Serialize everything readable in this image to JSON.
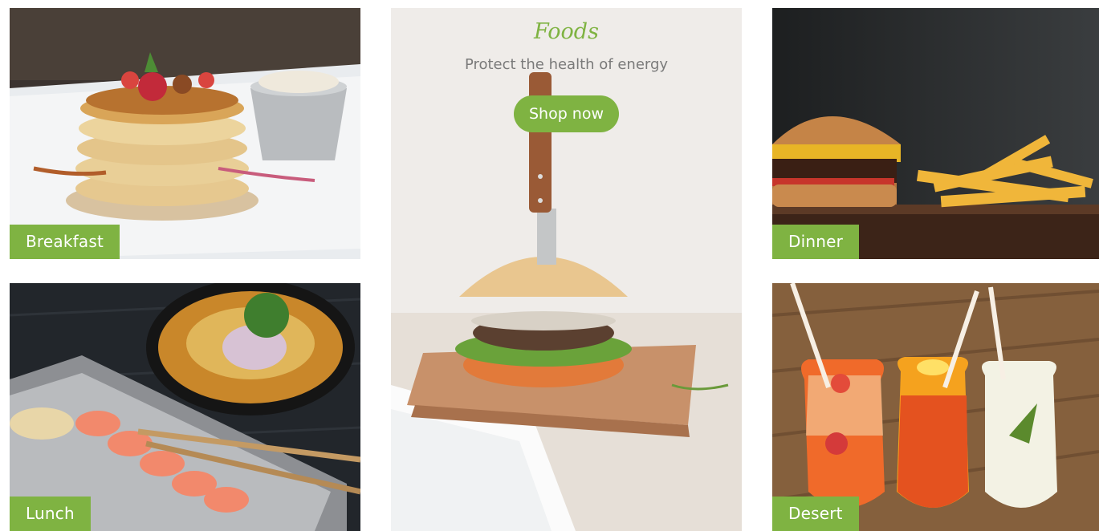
{
  "categories": {
    "breakfast": {
      "label": "Breakfast",
      "image": "pancake-stack-photo"
    },
    "dinner": {
      "label": "Dinner",
      "image": "burger-and-fries-photo"
    },
    "lunch": {
      "label": "Lunch",
      "image": "salmon-sashimi-bowl-photo"
    },
    "desert": {
      "label": "Desert",
      "image": "fruit-cocktails-photo"
    }
  },
  "feature": {
    "title": "Foods",
    "subtitle": "Protect the health of energy",
    "button_label": "Shop now",
    "image": "burger-with-knife-photo"
  },
  "colors": {
    "accent": "#7fb342",
    "subtitle": "#7a7a7a",
    "label_text": "#ffffff"
  }
}
